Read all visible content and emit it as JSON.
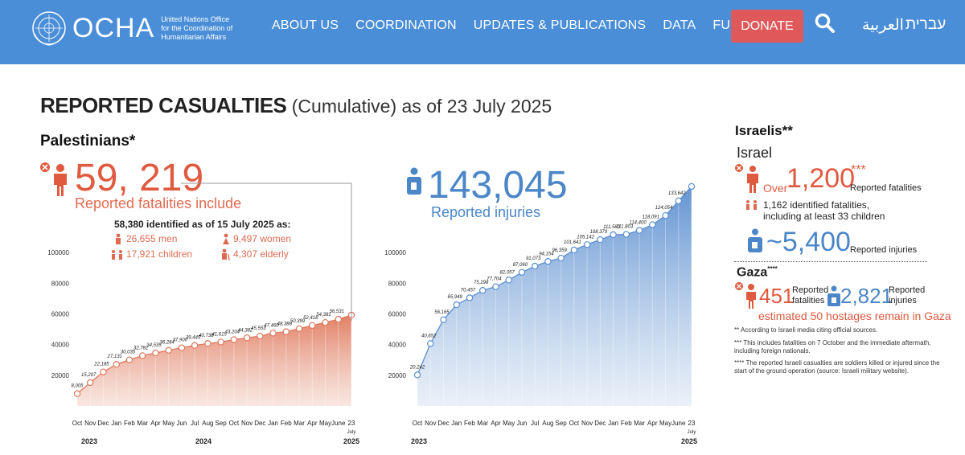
{
  "header": {
    "brand": "OCHA",
    "org_line1": "United Nations Office",
    "org_line2": "for the Coordination of",
    "org_line3": "Humanitarian Affairs",
    "nav": [
      "ABOUT US",
      "COORDINATION",
      "UPDATES & PUBLICATIONS",
      "DATA",
      "FUNDING"
    ],
    "donate": "DONATE",
    "lang_arabic": "العربية",
    "lang_hebrew": "עברית",
    "colors": {
      "bar": "#4a8ed8",
      "donate": "#e0595a"
    }
  },
  "title": {
    "bold": "REPORTED CASUALTIES",
    "rest": " (Cumulative) as of 23 July 2025"
  },
  "palestinians": {
    "heading": "Palestinians*",
    "fatalities_number": "59, 219",
    "fatalities_label": "Reported fatalities include",
    "identified_line": "58,380 identified as of 15 July 2025 as:",
    "men": "26,655 men",
    "women": "9,497 women",
    "children": "17,921 children",
    "elderly": "4,307 elderly",
    "injuries_number": "143,045",
    "injuries_label": "Reported injuries"
  },
  "israelis": {
    "heading": "Israelis**",
    "israel_heading": "Israel",
    "over": "Over",
    "fatalities_number": "1,200",
    "stars": "***",
    "fatalities_label": "Reported fatalities",
    "identified_line1": "1,162 identified fatalities,",
    "identified_line2": "including at least 33 children",
    "injuries_number": "~5,400",
    "injuries_label": "Reported injuries",
    "gaza_heading": "Gaza",
    "gaza_stars": "****",
    "gaza_fatalities": "451",
    "gaza_fat_label1": "Reported",
    "gaza_fat_label2": "fatalities",
    "gaza_injuries": "2,821",
    "gaza_inj_label1": "Reported",
    "gaza_inj_label2": "injuries",
    "hostages": "estimated 50 hostages remain in Gaza",
    "note1": "** According to Israeli media citing official sources.",
    "note2a": "*** This includes fatalities on 7 October and the immediate aftermath,",
    "note2b": "including foreign nationals.",
    "note3a": "**** The reported Israeli casualties are soldiers killed or injured since the",
    "note3b": "start of the ground operation (source: Israeli military website)."
  },
  "chart_data": [
    {
      "type": "area",
      "series": [
        {
          "name": "Reported fatalities",
          "color": "#e0785c"
        }
      ],
      "categories": [
        "Oct",
        "Nov",
        "Dec",
        "Jan",
        "Feb",
        "Mar",
        "Apr",
        "May",
        "Jun",
        "Jul",
        "Aug",
        "Sep",
        "Oct",
        "Nov",
        "Dec",
        "Jan",
        "Feb",
        "Mar",
        "Apr",
        "May",
        "June",
        "23 July"
      ],
      "values": [
        8005,
        15207,
        22185,
        27131,
        30035,
        32782,
        34535,
        36284,
        37900,
        39445,
        40738,
        41615,
        43204,
        44382,
        45553,
        47460,
        48388,
        50399,
        52418,
        54381,
        56531,
        59219
      ],
      "value_labels": [
        "8,005",
        "15,207",
        "22,185",
        "27,131",
        "30,035",
        "32,782",
        "34,535",
        "36,284",
        "37,900",
        "39,445",
        "40,738",
        "41,615",
        "43,204",
        "44,382",
        "45,553",
        "47,460",
        "48,388",
        "50,399",
        "52,418",
        "54,381",
        "56,531",
        ""
      ],
      "years": [
        "2023",
        "2024",
        "2025"
      ],
      "yticks": [
        20000,
        40000,
        60000,
        80000,
        100000
      ],
      "ylim": [
        0,
        110000
      ]
    },
    {
      "type": "area",
      "series": [
        {
          "name": "Reported injuries",
          "color": "#5b8fd0"
        }
      ],
      "categories": [
        "Oct",
        "Nov",
        "Dec",
        "Jan",
        "Feb",
        "Mar",
        "Apr",
        "May",
        "Jun",
        "Jul",
        "Aug",
        "Sep",
        "Oct",
        "Nov",
        "Dec",
        "Jan",
        "Feb",
        "Mar",
        "Apr",
        "May",
        "June",
        "23 July"
      ],
      "values": [
        20242,
        40652,
        56165,
        65949,
        70457,
        75298,
        77704,
        82057,
        87060,
        91073,
        94154,
        96359,
        101641,
        105142,
        108379,
        111580,
        111803,
        114400,
        118091,
        124054,
        133642,
        143045
      ],
      "value_labels": [
        "20,242",
        "40,652",
        "56,165",
        "65,949",
        "70,457",
        "75,298",
        "77,704",
        "82,057",
        "87,060",
        "91,073",
        "94,154",
        "96,359",
        "101,641",
        "105,142",
        "108,379",
        "111,580",
        "111,803",
        "114,400",
        "118,091",
        "124,054",
        "133,642",
        ""
      ],
      "years": [
        "2023",
        "2025"
      ],
      "yticks": [
        20000,
        40000,
        60000,
        80000,
        100000
      ],
      "ylim": [
        0,
        110000
      ]
    }
  ]
}
